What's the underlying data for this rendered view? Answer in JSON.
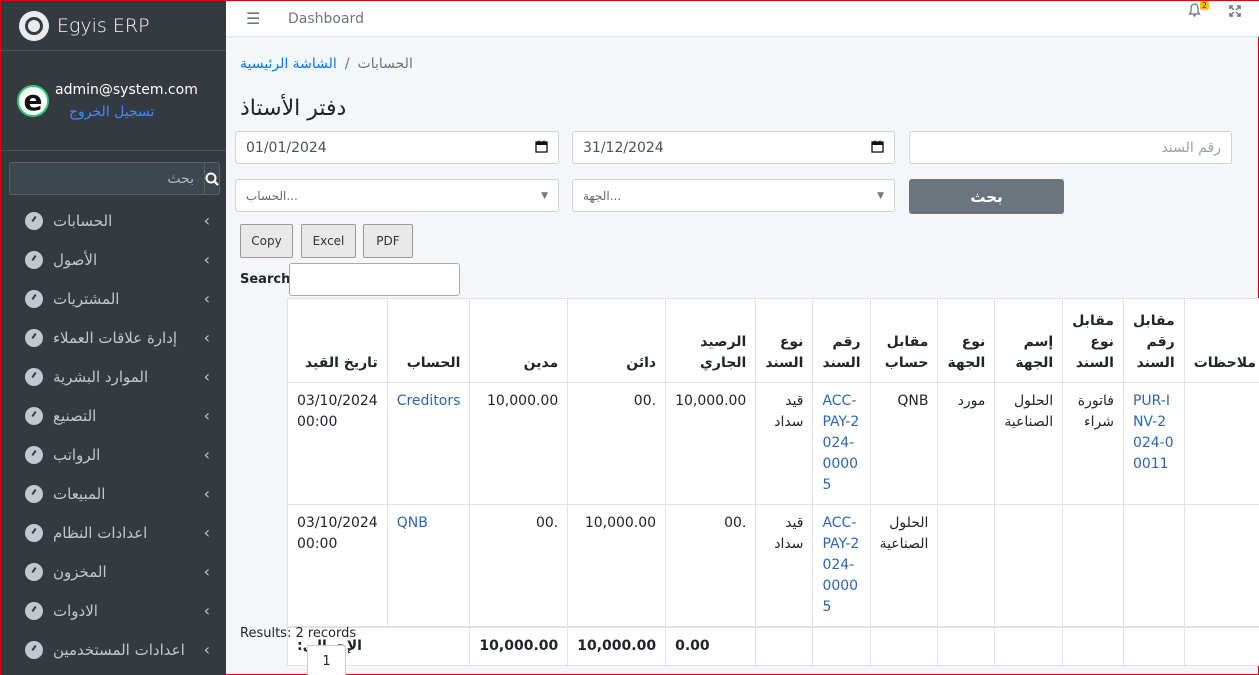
{
  "brand": {
    "name": "Egyis ERP"
  },
  "user": {
    "email": "admin@system.com",
    "logout": "تسجيل الخروج",
    "avatar_letter": "e"
  },
  "sidebar": {
    "search_placeholder": "بحث",
    "items": [
      {
        "label": "الحسابات"
      },
      {
        "label": "الأصول"
      },
      {
        "label": "المشتريات"
      },
      {
        "label": "إدارة علاقات العملاء"
      },
      {
        "label": "الموارد البشرية"
      },
      {
        "label": "التصنيع"
      },
      {
        "label": "الرواتب"
      },
      {
        "label": "المبيعات"
      },
      {
        "label": "اعدادات النظام"
      },
      {
        "label": "المخزون"
      },
      {
        "label": "الادوات"
      },
      {
        "label": "اعدادات المستخدمين"
      }
    ]
  },
  "topnav": {
    "title": "Dashboard",
    "notification_count": "2"
  },
  "breadcrumb": {
    "home": "الشاشة الرئيسية",
    "current": "الحسابات",
    "separator": "/"
  },
  "page": {
    "title": "دفتر الأستاذ"
  },
  "filters": {
    "date_from": "01/01/2024",
    "date_to": "31/12/2024",
    "doc_number_placeholder": "رقم السند",
    "account_placeholder": "الحساب...",
    "party_placeholder": "الجهة...",
    "search_button": "بحث"
  },
  "export": {
    "copy": "Copy",
    "excel": "Excel",
    "pdf": "PDF"
  },
  "dt": {
    "search_label": "Search:",
    "results": "Results: 2 records",
    "page": "1"
  },
  "table": {
    "headers": {
      "date": "تاريخ القيد",
      "account": "الحساب",
      "debit": "مدين",
      "credit": "دائن",
      "balance": "الرصيد الجاري",
      "doc_type": "نوع السند",
      "doc_no": "رقم السند",
      "counter_account": "مقابل حساب",
      "party_type": "نوع الجهة",
      "party_name": "إسم الجهة",
      "counter_doc_type": "مقابل نوع السند",
      "counter_doc_no": "مقابل رقم السند",
      "notes": "ملاحظات"
    },
    "rows": [
      {
        "date": "03/10/2024 00:00",
        "account": "Creditors",
        "debit": "10,000.00",
        "credit": ".00",
        "balance": "10,000.00",
        "doc_type": "قيد سداد",
        "doc_no": "ACC-PAY-2024-00005",
        "counter_account": "QNB",
        "party_type": "مورد",
        "party_name": "الحلول الصناعية",
        "counter_doc_type": "فاتورة شراء",
        "counter_doc_no": "PUR-INV-2024-00011",
        "notes": ""
      },
      {
        "date": "03/10/2024 00:00",
        "account": "QNB",
        "debit": ".00",
        "credit": "10,000.00",
        "balance": ".00",
        "doc_type": "قيد سداد",
        "doc_no": "ACC-PAY-2024-00005",
        "counter_account": "الحلول الصناعية",
        "party_type": "",
        "party_name": "",
        "counter_doc_type": "",
        "counter_doc_no": "",
        "notes": ""
      }
    ],
    "totals": {
      "label": "الإجمالي:",
      "debit": "10,000.00",
      "credit": "10,000.00",
      "balance": "0.00"
    }
  }
}
